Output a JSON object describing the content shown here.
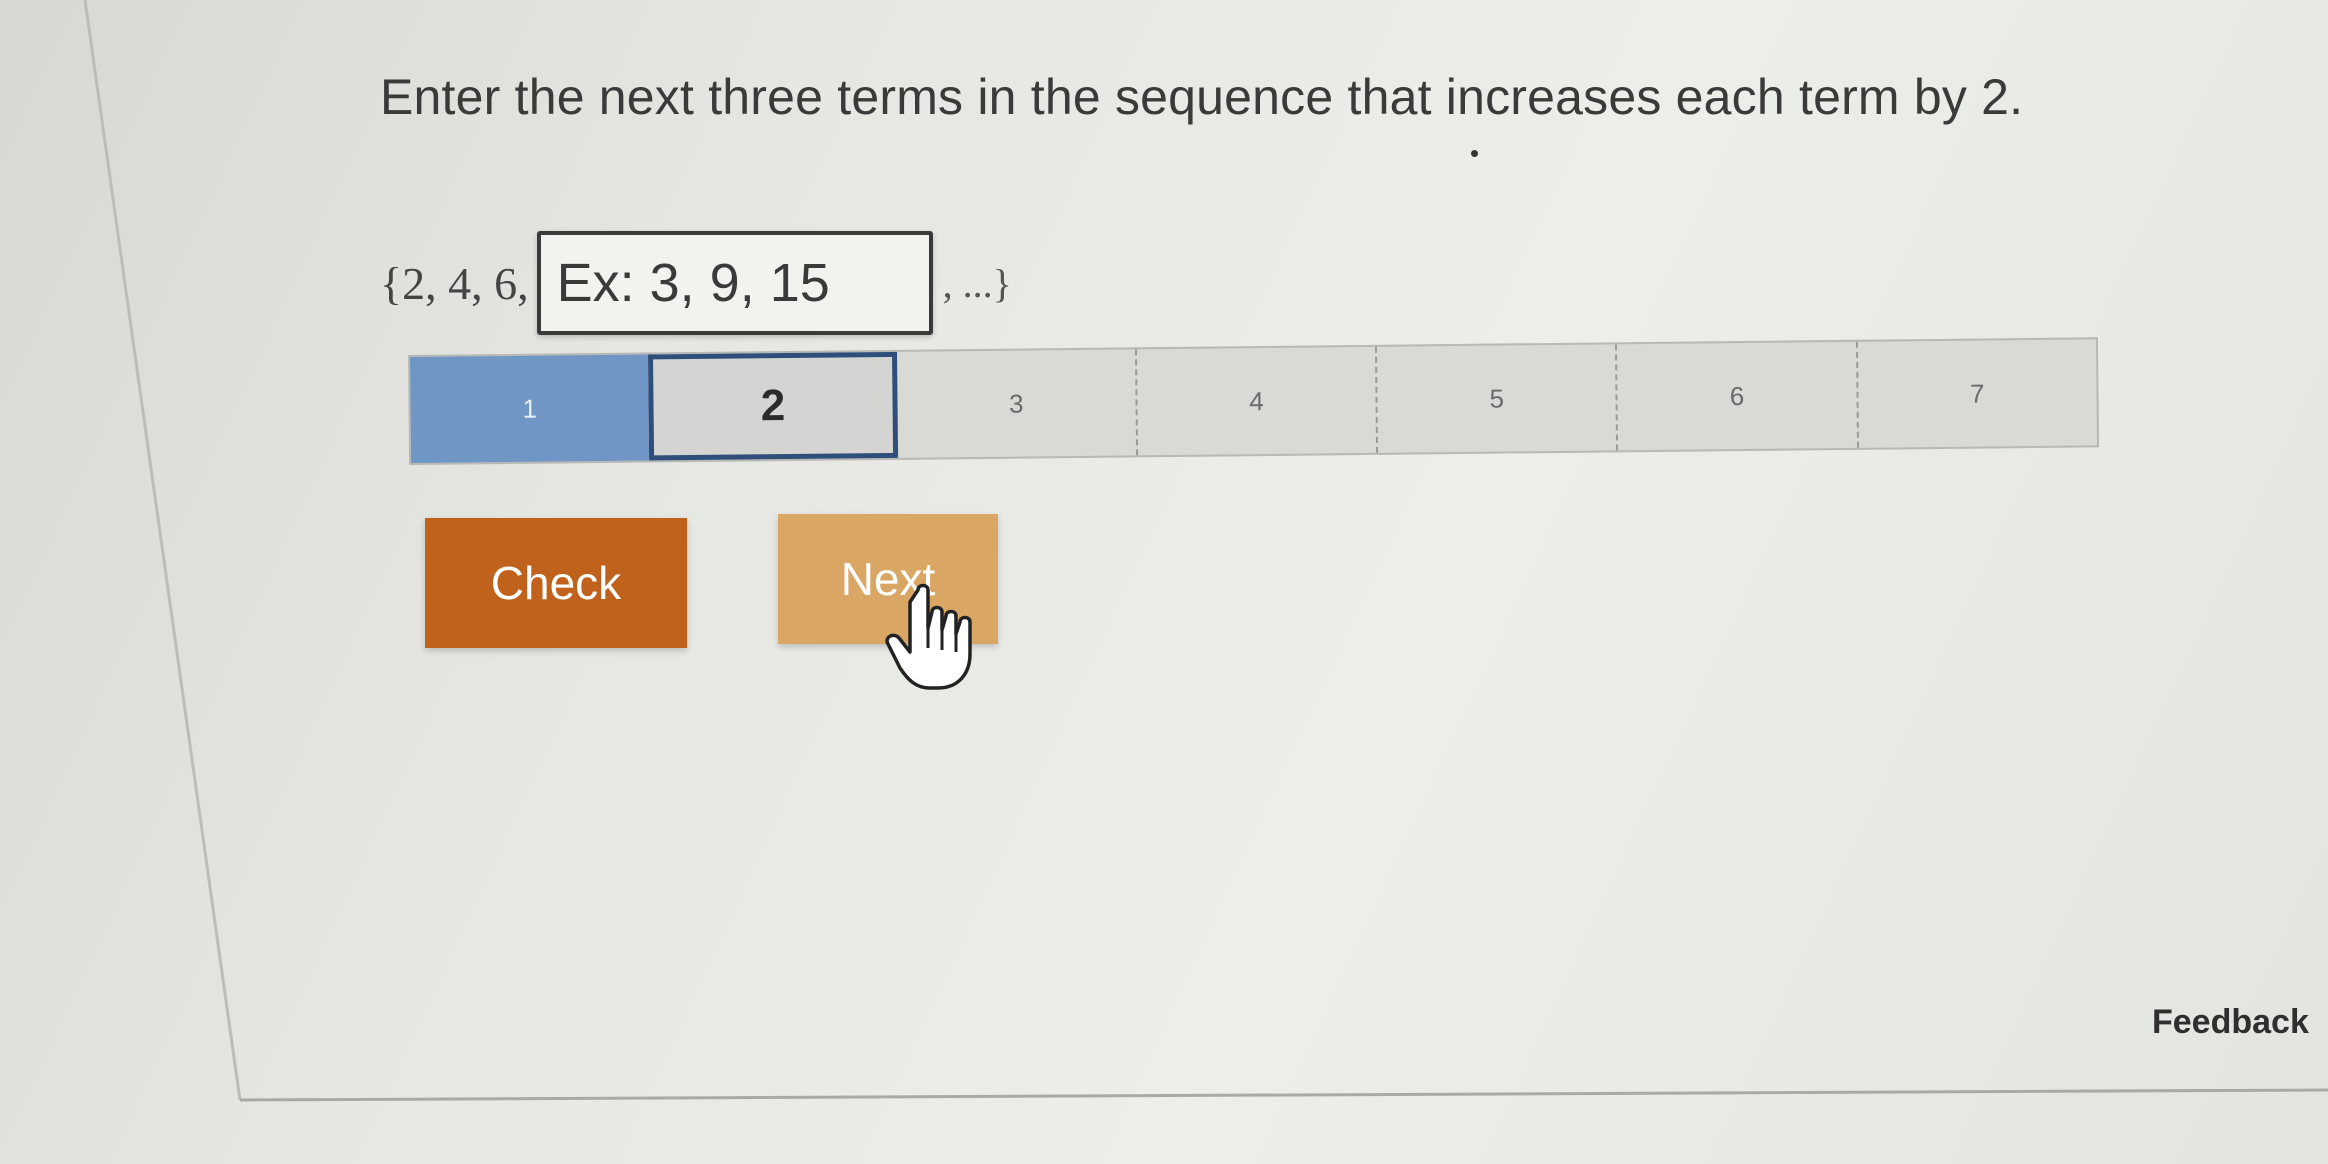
{
  "question": {
    "text": "Enter the next three terms in the sequence that increases each term by 2."
  },
  "sequence": {
    "prefix": "{2, 4, 6,",
    "input_value": "",
    "input_placeholder": "Ex: 3, 9, 15",
    "suffix": ", ...}"
  },
  "progress": {
    "steps": [
      "1",
      "2",
      "3",
      "4",
      "5",
      "6",
      "7"
    ],
    "current_step": 2,
    "completed_steps": 1
  },
  "buttons": {
    "check_label": "Check",
    "next_label": "Next"
  },
  "footer": {
    "feedback_label": "Feedback"
  },
  "colors": {
    "check_button": "#c0621b",
    "next_button": "#d9a664",
    "progress_completed": "#6f96c4",
    "progress_current_border": "#2f4f7a"
  },
  "icons": {
    "cursor": "hand-pointer-icon"
  }
}
